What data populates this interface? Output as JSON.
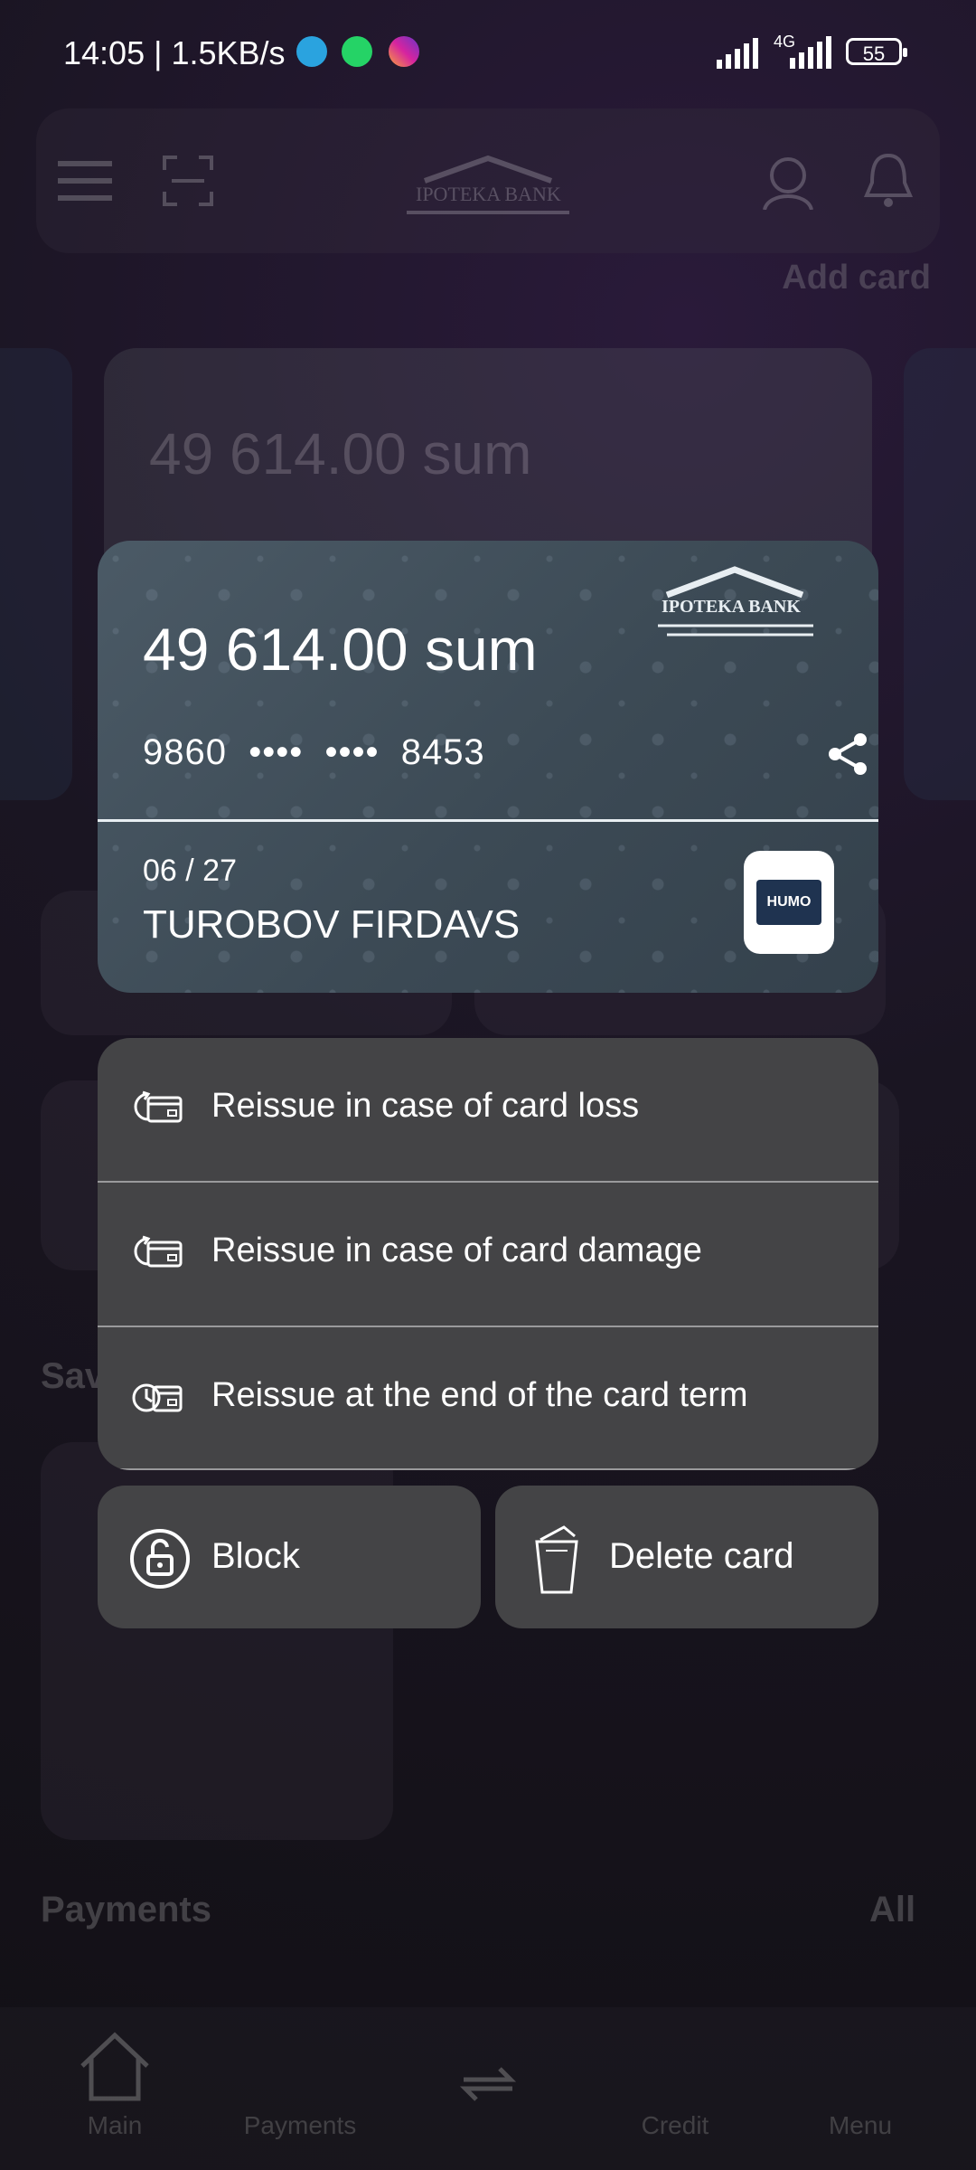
{
  "status_bar": {
    "time_speed": "14:05 | 1.5KB/s",
    "network": "4G",
    "battery": "55"
  },
  "background": {
    "bank_name": "IPOTEKA BANK",
    "add_card": "Add card",
    "card_amount": "49 614.00 sum",
    "savings_label": "Sav",
    "payments_label": "Payments",
    "all_label": "All",
    "nav": {
      "main": "Main",
      "payments": "Payments",
      "credit": "Credit",
      "menu": "Menu"
    }
  },
  "card": {
    "bank_name": "IPOTEKA BANK",
    "amount": "49 614.00 sum",
    "number": "9860  ••••  ••••  8453",
    "expiry": "06 / 27",
    "holder": "TUROBOV FIRDAVS",
    "brand": "HUMO"
  },
  "menu": {
    "items": [
      {
        "label": "Reissue in case of card loss",
        "icon": "card-refresh-icon"
      },
      {
        "label": "Reissue in case of card damage",
        "icon": "card-refresh-icon"
      },
      {
        "label": "Reissue at the end of the card term",
        "icon": "card-clock-icon"
      }
    ]
  },
  "actions": {
    "block": "Block",
    "delete": "Delete card"
  },
  "colors": {
    "card": "#3c4a55",
    "menu": "#444446",
    "overlay_bg": "#16121c"
  }
}
